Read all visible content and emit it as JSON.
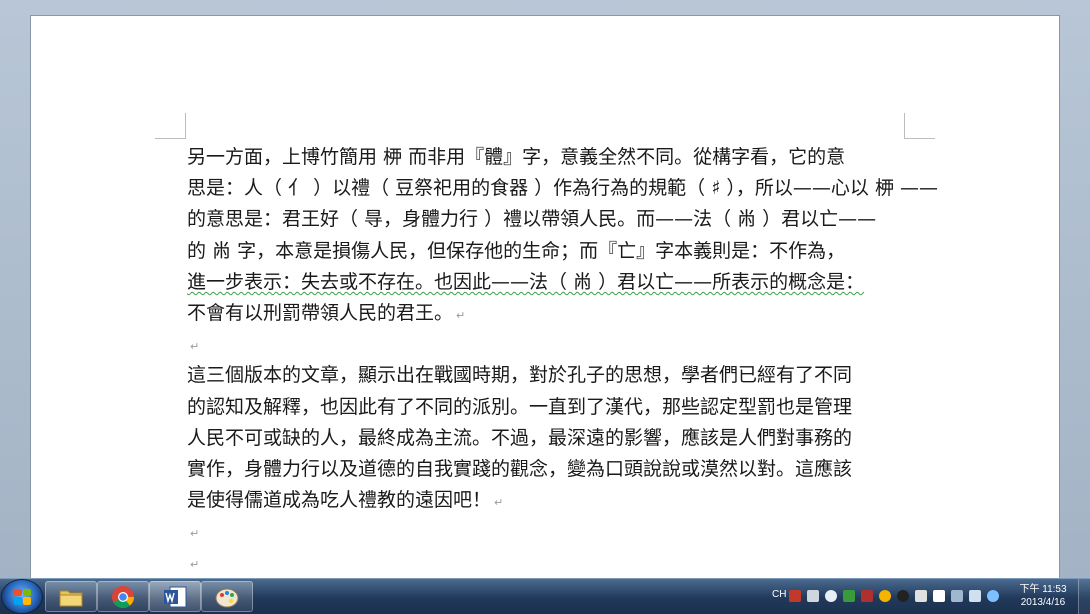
{
  "document": {
    "paragraph1": [
      "另一方面，上博竹簡用 𫞉 而非用『體』字，意義全然不同。從構字看，它的意",
      "思是：人（ 亻 ）以禮（ 豆祭祀用的食器 ）作為行為的規範（ ♯ ），所以——心以 𫞉 ——",
      "的意思是：君王好（ 㝵，身體力行 ）禮以帶領人民。而——法（ 㡀 ）君以亡——",
      "的 㡀 字，本意是損傷人民，但保存他的生命；而『亡』字本義則是：不作為，",
      "進一步表示：失去或不存在。也因此——法（ 㡀 ）君以亡——所表示的概念是：",
      "不會有以刑罰帶領人民的君王。"
    ],
    "paragraph2": [
      "這三個版本的文章，顯示出在戰國時期，對於孔子的思想，學者們已經有了不同",
      "的認知及解釋，也因此有了不同的派別。一直到了漢代，那些認定型罰也是管理",
      "人民不可或缺的人，最終成為主流。不過，最深遠的影響，應該是人們對事務的",
      "實作，身體力行以及道德的自我實踐的觀念，變為口頭說說或漠然以對。這應該",
      "是使得儒道成為吃人禮教的遠因吧！"
    ],
    "paragraph_mark": "↵"
  },
  "taskbar": {
    "pinned": [
      {
        "name": "explorer",
        "icon": "folder-icon"
      },
      {
        "name": "chrome",
        "icon": "chrome-icon"
      },
      {
        "name": "word",
        "icon": "word-icon"
      },
      {
        "name": "paint",
        "icon": "paint-icon"
      }
    ],
    "tray": {
      "language": "CH",
      "time": "下午 11:53",
      "date": "2013/4/16"
    }
  },
  "colors": {
    "taskbar": "#21395a",
    "spellcheck_underline": "#3aa04a",
    "page": "#ffffff"
  }
}
